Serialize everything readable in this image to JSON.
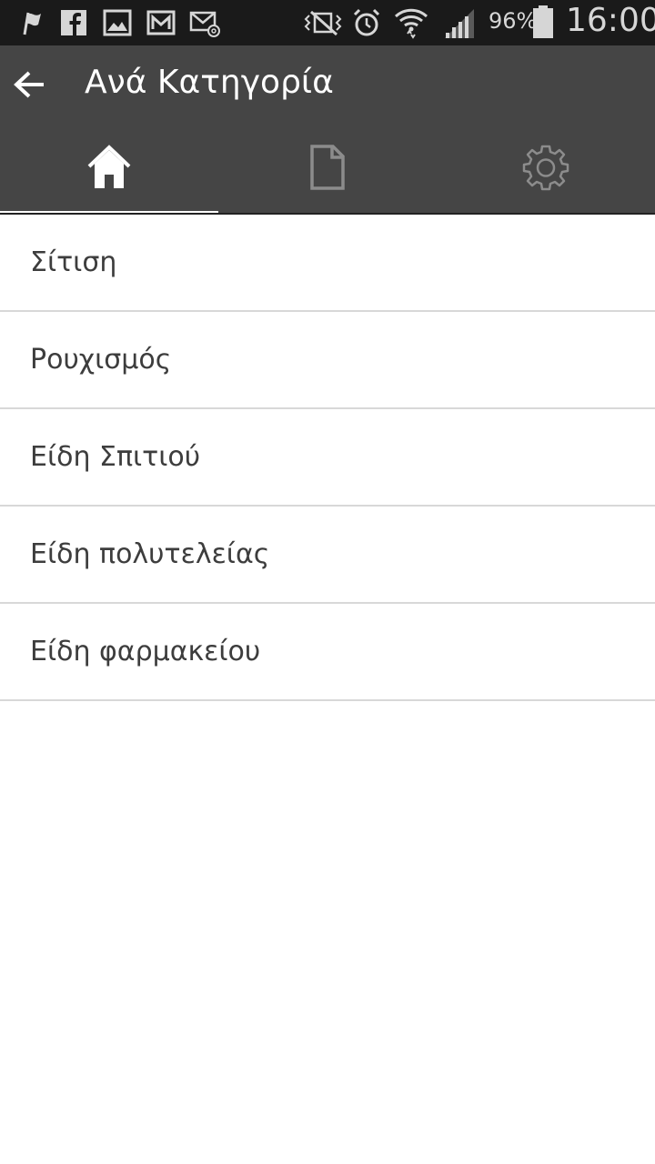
{
  "status_bar": {
    "icons_left": [
      "flag-icon",
      "facebook-icon",
      "gallery-icon",
      "gmail-icon",
      "email-icon"
    ],
    "icons_right": [
      "vibrate-mute-icon",
      "alarm-icon",
      "wifi-icon",
      "signal-icon",
      "battery-icon"
    ],
    "battery": "96%",
    "time": "16:00"
  },
  "app_bar": {
    "title": "Ανά Κατηγορία"
  },
  "tabs": [
    {
      "icon": "home-icon",
      "active": true
    },
    {
      "icon": "document-icon",
      "active": false
    },
    {
      "icon": "settings-icon",
      "active": false
    }
  ],
  "categories": [
    {
      "label": "Σίτιση"
    },
    {
      "label": "Ρουχισμός"
    },
    {
      "label": "Είδη Σπιτιού"
    },
    {
      "label": "Είδη πολυτελείας"
    },
    {
      "label": "Είδη φαρμακείου"
    }
  ],
  "colors": {
    "status_bar_bg": "#1a1a1a",
    "app_bar_bg": "#454545",
    "list_text": "#3d3d3d",
    "divider": "#d8d8d8"
  }
}
